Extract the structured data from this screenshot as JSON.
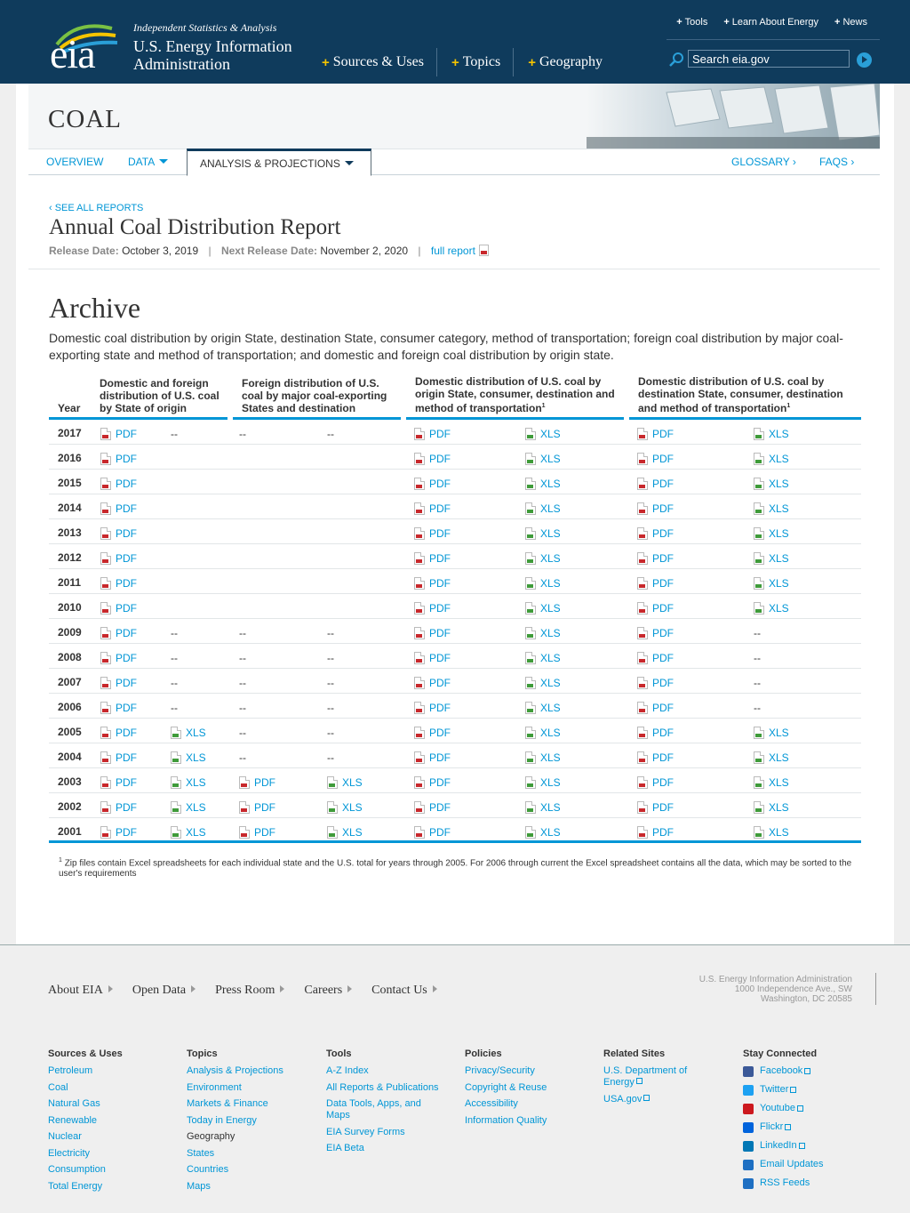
{
  "header": {
    "logo_text": "eia",
    "tagline": "Independent Statistics & Analysis",
    "agency_line1": "U.S. Energy Information",
    "agency_line2": "Administration",
    "main_nav": [
      "Sources & Uses",
      "Topics",
      "Geography"
    ],
    "utility_nav": [
      "Tools",
      "Learn About Energy",
      "News"
    ],
    "search_placeholder": "Search eia.gov"
  },
  "section": {
    "title": "COAL",
    "subnav": {
      "overview": "OVERVIEW",
      "data": "DATA",
      "analysis": "ANALYSIS & PROJECTIONS",
      "glossary": "GLOSSARY ›",
      "faqs": "FAQS ›"
    }
  },
  "report": {
    "see_all": "‹ SEE ALL REPORTS",
    "title": "Annual Coal Distribution Report",
    "release_label": "Release Date:",
    "release_date": "October 3, 2019",
    "next_label": "Next Release Date:",
    "next_date": "November 2, 2020",
    "full_report": "full report"
  },
  "archive": {
    "title": "Archive",
    "description": "Domestic coal distribution by origin State, destination State, consumer category, method of transportation; foreign coal distribution by major coal-exporting state and method of transportation; and domestic and foreign coal distribution by origin state.",
    "columns": {
      "year": "Year",
      "c1": "Domestic and foreign distribution of U.S. coal by State of origin",
      "c2": "Foreign distribution of U.S. coal by major coal-exporting States and destination",
      "c3": "Domestic distribution of U.S. coal by origin State, consumer, destination and method of transportation",
      "c4": "Domestic distribution of U.S. coal by destination State, consumer, destination and method of transportation",
      "footnote_mark": "1"
    },
    "rows": [
      {
        "year": "2017",
        "cells": [
          "PDF",
          "--",
          "--",
          "--",
          "PDF",
          "XLS",
          "PDF",
          "XLS"
        ]
      },
      {
        "year": "2016",
        "cells": [
          "PDF",
          "",
          "",
          "",
          "PDF",
          "XLS",
          "PDF",
          "XLS"
        ]
      },
      {
        "year": "2015",
        "cells": [
          "PDF",
          "",
          "",
          "",
          "PDF",
          "XLS",
          "PDF",
          "XLS"
        ]
      },
      {
        "year": "2014",
        "cells": [
          "PDF",
          "",
          "",
          "",
          "PDF",
          "XLS",
          "PDF",
          "XLS"
        ]
      },
      {
        "year": "2013",
        "cells": [
          "PDF",
          "",
          "",
          "",
          "PDF",
          "XLS",
          "PDF",
          "XLS"
        ]
      },
      {
        "year": "2012",
        "cells": [
          "PDF",
          "",
          "",
          "",
          "PDF",
          "XLS",
          "PDF",
          "XLS"
        ]
      },
      {
        "year": "2011",
        "cells": [
          "PDF",
          "",
          "",
          "",
          "PDF",
          "XLS",
          "PDF",
          "XLS"
        ]
      },
      {
        "year": "2010",
        "cells": [
          "PDF",
          "",
          "",
          "",
          "PDF",
          "XLS",
          "PDF",
          "XLS"
        ]
      },
      {
        "year": "2009",
        "cells": [
          "PDF",
          "--",
          "--",
          "--",
          "PDF",
          "XLS",
          "PDF",
          "--"
        ]
      },
      {
        "year": "2008",
        "cells": [
          "PDF",
          "--",
          "--",
          "--",
          "PDF",
          "XLS",
          "PDF",
          "--"
        ]
      },
      {
        "year": "2007",
        "cells": [
          "PDF",
          "--",
          "--",
          "--",
          "PDF",
          "XLS",
          "PDF",
          "--"
        ]
      },
      {
        "year": "2006",
        "cells": [
          "PDF",
          "--",
          "--",
          "--",
          "PDF",
          "XLS",
          "PDF",
          "--"
        ]
      },
      {
        "year": "2005",
        "cells": [
          "PDF",
          "XLS",
          "--",
          "--",
          "PDF",
          "XLS",
          "PDF",
          "XLS"
        ]
      },
      {
        "year": "2004",
        "cells": [
          "PDF",
          "XLS",
          "--",
          "--",
          "PDF",
          "XLS",
          "PDF",
          "XLS"
        ]
      },
      {
        "year": "2003",
        "cells": [
          "PDF",
          "XLS",
          "PDF",
          "XLS",
          "PDF",
          "XLS",
          "PDF",
          "XLS"
        ]
      },
      {
        "year": "2002",
        "cells": [
          "PDF",
          "XLS",
          "PDF",
          "XLS",
          "PDF",
          "XLS",
          "PDF",
          "XLS"
        ]
      },
      {
        "year": "2001",
        "cells": [
          "PDF",
          "XLS",
          "PDF",
          "XLS",
          "PDF",
          "XLS",
          "PDF",
          "XLS"
        ]
      }
    ],
    "footnote_number": "1",
    "footnote": "Zip files contain Excel spreadsheets for each individual state and the U.S. total for years through 2005. For 2006 through current the Excel spreadsheet contains all the data, which may be sorted to the user's requirements"
  },
  "footer": {
    "links": [
      "About EIA",
      "Open Data",
      "Press Room",
      "Careers",
      "Contact Us"
    ],
    "address": [
      "U.S. Energy Information Administration",
      "1000 Independence Ave., SW",
      "Washington, DC 20585"
    ],
    "columns": [
      {
        "heading": "Sources & Uses",
        "items": [
          "Petroleum",
          "Coal",
          "Natural Gas",
          "Renewable",
          "Nuclear",
          "Electricity",
          "Consumption",
          "Total Energy"
        ]
      },
      {
        "heading": "Topics",
        "items": [
          "Analysis & Projections",
          "Environment",
          "Markets & Finance",
          "Today in Energy"
        ],
        "subheading": "Geography",
        "subitems": [
          "States",
          "Countries",
          "Maps"
        ]
      },
      {
        "heading": "Tools",
        "items": [
          "A-Z Index",
          "All Reports & Publications",
          "Data Tools, Apps, and Maps",
          "EIA Survey Forms",
          "EIA Beta"
        ]
      },
      {
        "heading": "Policies",
        "items": [
          "Privacy/Security",
          "Copyright & Reuse",
          "Accessibility",
          "Information Quality"
        ]
      },
      {
        "heading": "Related Sites",
        "items": [
          "U.S. Department of Energy",
          "USA.gov"
        ]
      },
      {
        "heading": "Stay Connected",
        "items": [
          "Facebook",
          "Twitter",
          "Youtube",
          "Flickr",
          "LinkedIn",
          "Email Updates",
          "RSS Feeds"
        ]
      }
    ]
  },
  "colors": {
    "header_bg": "#0f3b5c",
    "link": "#0096d6",
    "accent_yellow": "#f5c400",
    "pdf_red": "#c8282c",
    "xls_green": "#3f9b3a"
  },
  "icons": {
    "pdf": "pdf-file-icon",
    "xls": "xls-file-icon",
    "search": "search-icon",
    "external": "external-link-icon"
  }
}
